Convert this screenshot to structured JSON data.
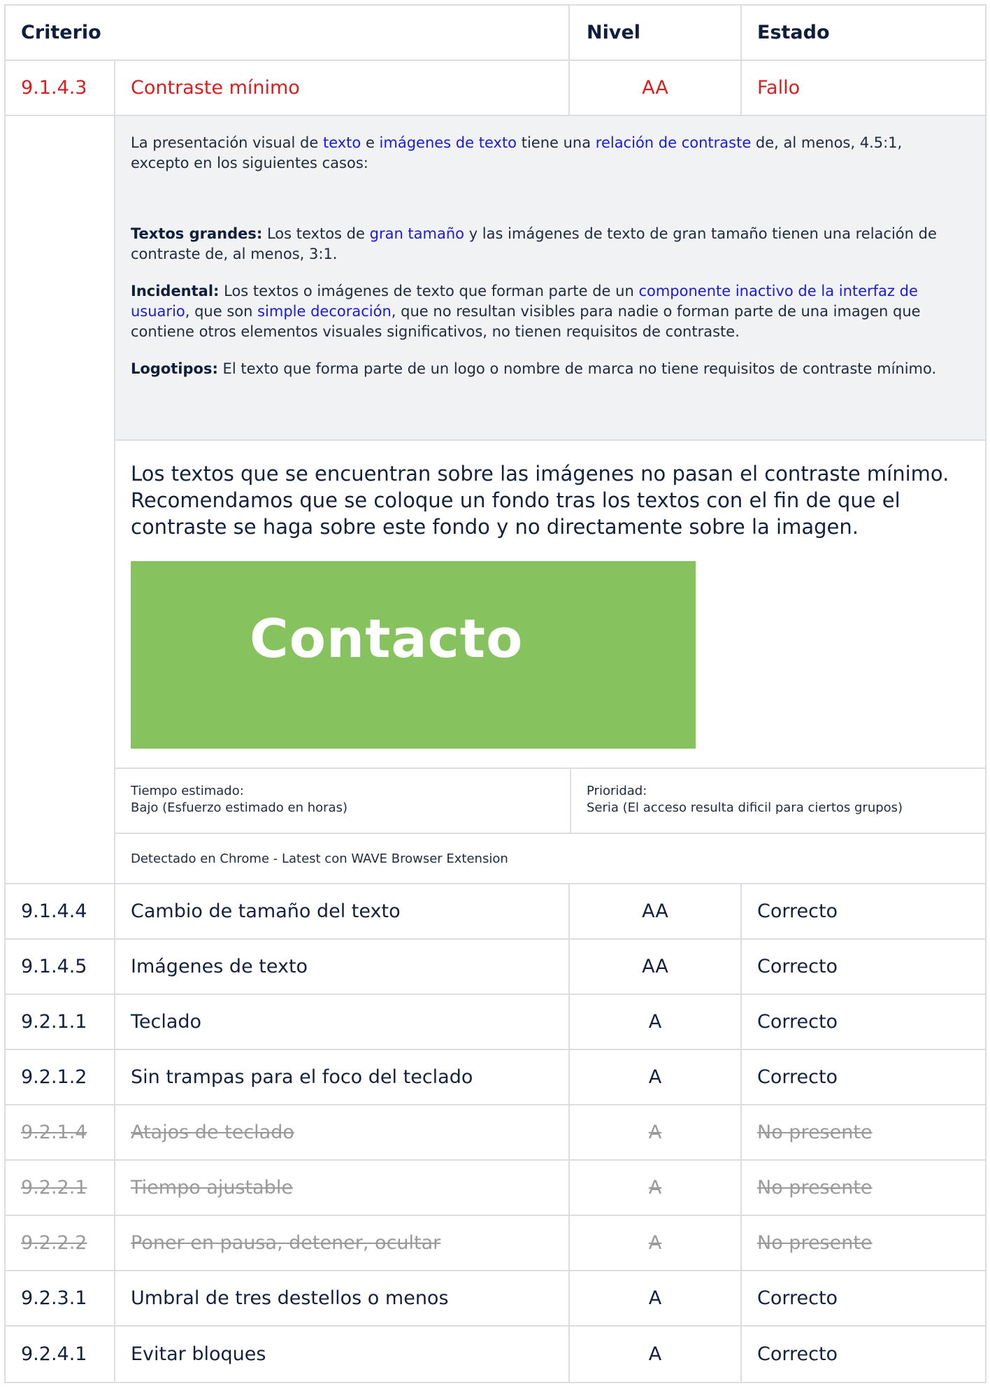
{
  "header": {
    "criterio": "Criterio",
    "nivel": "Nivel",
    "estado": "Estado"
  },
  "expanded_row": {
    "id": "9.1.4.3",
    "name": "Contraste mínimo",
    "level": "AA",
    "status": "Fallo",
    "status_color": "#d81e1e",
    "wcag": {
      "intro": {
        "t1": "La presentación visual de ",
        "l1": "texto",
        "t2": " e ",
        "l2": "imágenes de texto",
        "t3": " tiene una ",
        "l3": "relación de contraste",
        "t4": " de, al menos, 4.5:1, excepto en los siguientes casos:"
      },
      "large": {
        "label": "Textos grandes:",
        "t1": " Los textos de ",
        "l1": "gran tamaño",
        "t2": " y las imágenes de texto de gran tamaño tienen una relación de contraste de, al menos, 3:1."
      },
      "incidental": {
        "label": "Incidental:",
        "t1": " Los textos o imágenes de texto que forman parte de un ",
        "l1": "componente inactivo de la interfaz de usuario",
        "t2": ", que son ",
        "l2": "simple decoración",
        "t3": ", que no resultan visibles para nadie o forman parte de una imagen que contiene otros elementos visuales significativos, no tienen requisitos de contraste."
      },
      "logos": {
        "label": "Logotipos:",
        "t1": " El texto que forma parte de un logo o nombre de marca no tiene requisitos de contraste mínimo."
      }
    },
    "finding": "Los textos que se encuentran sobre las imágenes no pasan el contraste mínimo. Recomendamos que se coloque un fondo tras los textos con el fin de que el contraste se haga sobre este fondo y no directamente sobre la imagen.",
    "image_text": "Contacto",
    "image_color": "#86c35e",
    "time_label": "Tiempo estimado:",
    "time_value": "Bajo (Esfuerzo estimado en horas)",
    "priority_label": "Prioridad:",
    "priority_value": "Seria (El acceso resulta dificil para ciertos grupos)",
    "detected": "Detectado en Chrome - Latest con WAVE Browser Extension"
  },
  "rows": [
    {
      "id": "9.1.4.4",
      "name": "Cambio de tamaño del texto",
      "level": "AA",
      "status": "Correcto"
    },
    {
      "id": "9.1.4.5",
      "name": "Imágenes de texto",
      "level": "AA",
      "status": "Correcto"
    },
    {
      "id": "9.2.1.1",
      "name": "Teclado",
      "level": "A",
      "status": "Correcto"
    },
    {
      "id": "9.2.1.2",
      "name": "Sin trampas para el foco del teclado",
      "level": "A",
      "status": "Correcto"
    },
    {
      "id": "9.2.1.4",
      "name": "Atajos de teclado",
      "level": "A",
      "status": "No presente"
    },
    {
      "id": "9.2.2.1",
      "name": "Tiempo ajustable",
      "level": "A",
      "status": "No presente"
    },
    {
      "id": "9.2.2.2",
      "name": "Poner en pausa, detener, ocultar",
      "level": "A",
      "status": "No presente"
    },
    {
      "id": "9.2.3.1",
      "name": "Umbral de tres destellos o menos",
      "level": "A",
      "status": "Correcto"
    },
    {
      "id": "9.2.4.1",
      "name": "Evitar bloques",
      "level": "A",
      "status": "Correcto"
    }
  ]
}
